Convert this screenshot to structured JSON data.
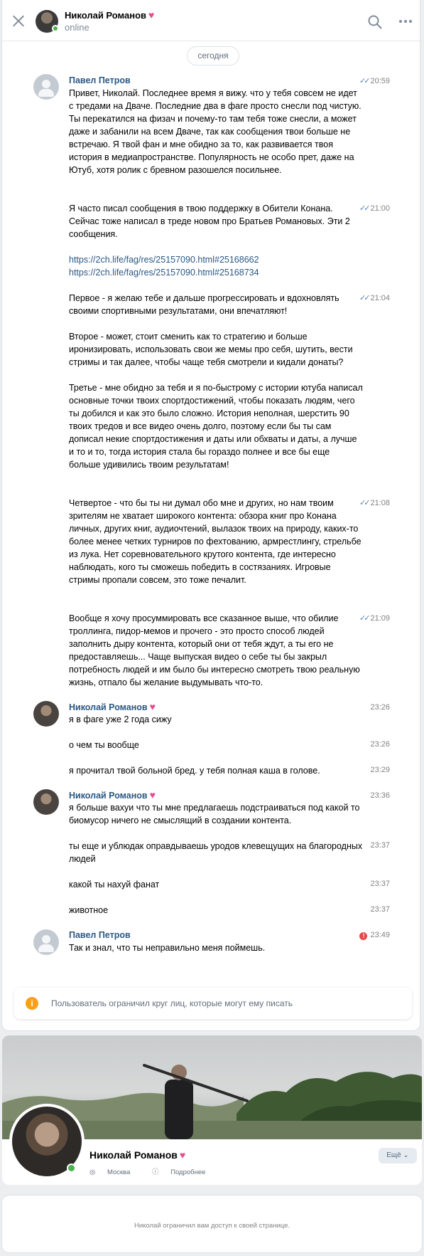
{
  "header": {
    "name": "Николай Романов",
    "status": "online",
    "heart": "♥",
    "icons": [
      "close-icon",
      "search-icon",
      "more-icon"
    ]
  },
  "date_divider": "сегодня",
  "messages": [
    {
      "sender": "Павел Петров",
      "time": "20:59",
      "read_mark": "✓✓",
      "text": "Привет, Николай. Последнее время я вижу. что у тебя совсем не идет с тредами на Дваче. Последние два в фаге просто снесли под чистую. Ты перекатился на физач и почему-то там тебя тоже снесли, а может даже и забанили на всем Дваче, так как сообщения твои больше не встречаю. Я твой фан и мне обидно за то, как развивается твоя история в медиапространстве. Популярность не особо прет, даже на Ютуб, хотя ролик с бревном разошелся посильнее."
    },
    {
      "time": "21:00",
      "read_mark": "✓✓",
      "text": "Я часто писал сообщения в твою поддержку в Обители Конана. Сейчас тоже написал в треде новом про Братьев Романовых. Эти 2 сообщения.",
      "links": [
        "https://2ch.life/fag/res/25157090.html#25168662",
        "https://2ch.life/fag/res/25157090.html#25168734"
      ]
    },
    {
      "time": "21:04",
      "read_mark": "✓✓",
      "text": "Первое - я желаю тебе и дальше прогрессировать и вдохновлять своими спортивными результатами, они впечатляют!",
      "text2": "Второе - может, стоит сменить как то стратегию и больше иронизировать, использовать свои же мемы про себя, шутить, вести стримы и так далее, чтобы чаще тебя смотрели и кидали донаты?",
      "text3": "Третье - мне обидно за тебя и я по-быстрому с истории ютуба написал основные точки твоих спортдостижений, чтобы показать людям, чего ты добился и как это было сложно. История неполная, шерстить 90 твоих тредов и все видео очень долго, поэтому если бы ты сам дописал некие спортдостижения и даты или обхваты и даты, а лучше и то и то, тогда история стала бы гораздо полнее и все бы еще больше удивились твоим результатам!"
    },
    {
      "time": "21:08",
      "read_mark": "✓✓",
      "text": "Четвертое - что бы ты ни думал обо мне и других, но нам твоим зрителям не хватает широкого контента: обзора книг про Конана личных, других книг, аудиочтений, вылазок твоих на природу, каких-то более менее четких турниров по фехтованию, армрестлингу, стрельбе из лука. Нет соревновательного крутого контента, где интересно наблюдать, кого ты сможешь победить в состязаниях. Игровые стримы пропали совсем, это тоже печалит."
    },
    {
      "time": "21:09",
      "read_mark": "✓✓",
      "text": "Вообще я хочу просуммировать все сказанное выше, что обилие троллинга, пидор-мемов и прочего - это просто способ людей заполнить дыру контента, который они от тебя ждут, а ты его не предоставляешь... Чаще выпуская видео о себе ты бы закрыл потребность людей и им было бы интересно смотреть твою реальную жизнь, отпало бы желание выдумывать что-то."
    },
    {
      "sender": "Николай Романов",
      "time": "23:26",
      "text": "я в фаге уже 2 года сижу"
    },
    {
      "time": "23:26",
      "text": "о чем ты вообще"
    },
    {
      "time": "23:29",
      "text": "я прочитал твой больной бред. у тебя полная каша в голове."
    },
    {
      "sender": "Николай Романов",
      "time": "23:36",
      "text": "я больше вахуи что ты мне предлагаешь подстраиваться под какой то биомусор ничего не смыслящий в создании контента."
    },
    {
      "time": "23:37",
      "text": "ты еще и ублюдак оправдываешь уродов клевещущих на благородных людей"
    },
    {
      "time": "23:37",
      "text": "какой ты нахуй фанат"
    },
    {
      "time": "23:37",
      "text": "животное"
    },
    {
      "sender": "Павел Петров",
      "time": "23:49",
      "error_mark": "!",
      "text": "Так и знал, что ты неправильно меня поймешь."
    }
  ],
  "restriction": {
    "icon": "i",
    "text": "Пользователь ограничил круг лиц, которые могут ему писать"
  },
  "profile": {
    "name": "Николай Романов",
    "heart": "♥",
    "city": "Москва",
    "details": "Подробнее",
    "more_button": "Ещё ⌄"
  },
  "closed_notice": "Николай ограничил вам доступ к своей странице.",
  "colors": {
    "link": "#2a5885",
    "online": "#4bb34b",
    "heart": "#e64d8c",
    "warning": "#f8a01c",
    "error": "#e64646"
  }
}
